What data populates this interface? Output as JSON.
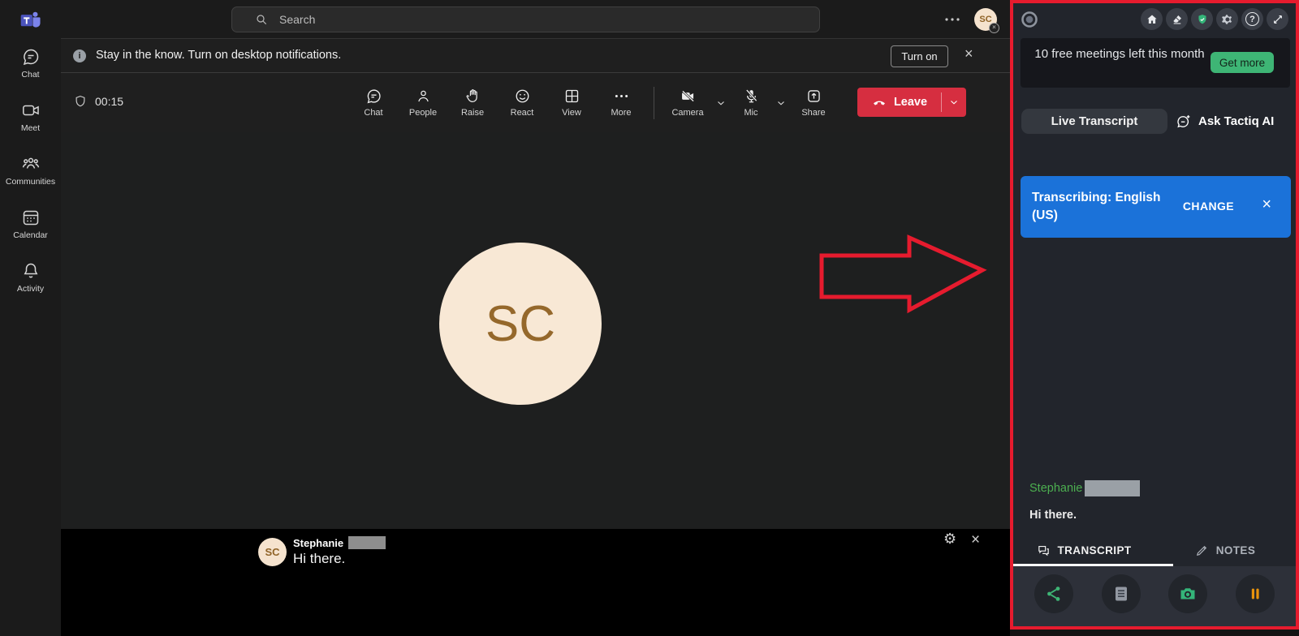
{
  "colors": {
    "annotation_red": "#e61b2e",
    "accent_blue": "#1b72d9",
    "accent_green": "#3eb575",
    "leave_red": "#d62e40",
    "speaker_green": "#4caf50",
    "pause_orange": "#e8930c"
  },
  "icons": {
    "info_glyph": "i",
    "help_glyph": "?",
    "gear_glyph": "⚙",
    "close_glyph": "×"
  },
  "sidebar": {
    "items": [
      {
        "label": "Chat"
      },
      {
        "label": "Meet"
      },
      {
        "label": "Communities"
      },
      {
        "label": "Calendar"
      },
      {
        "label": "Activity"
      }
    ]
  },
  "topbar": {
    "search_placeholder": "Search",
    "avatar_initials": "SC"
  },
  "notification": {
    "message": "Stay in the know. Turn on desktop notifications.",
    "action_label": "Turn on"
  },
  "meeting": {
    "timer": "00:15",
    "controls": {
      "chat": "Chat",
      "people": "People",
      "raise": "Raise",
      "react": "React",
      "view": "View",
      "more": "More",
      "camera": "Camera",
      "mic": "Mic",
      "share": "Share",
      "leave": "Leave"
    },
    "stage_avatar_initials": "SC",
    "caption": {
      "avatar_initials": "SC",
      "speaker": "Stephanie",
      "text": "Hi there."
    }
  },
  "tactiq": {
    "quota_text": "10 free meetings left this month",
    "quota_action": "Get more",
    "tab_live": "Live Transcript",
    "tab_ask": "Ask Tactiq AI",
    "transcribing_label": "Transcribing: English (US)",
    "change_label": "CHANGE",
    "entry": {
      "speaker": "Stephanie",
      "text": "Hi there."
    },
    "tab_transcript": "TRANSCRIPT",
    "tab_notes": "NOTES"
  }
}
